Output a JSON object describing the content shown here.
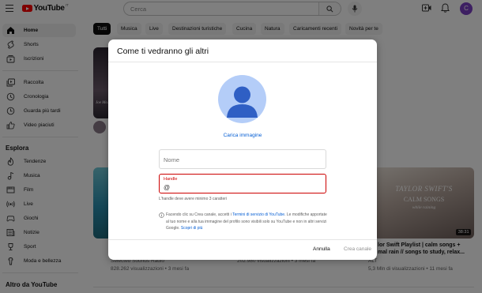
{
  "header": {
    "logo_text": "YouTube",
    "logo_country": "IT",
    "search_placeholder": "Cerca",
    "avatar_letter": "C"
  },
  "sidebar": {
    "items": [
      {
        "label": "Home",
        "icon": "home-icon",
        "active": true
      },
      {
        "label": "Shorts",
        "icon": "shorts-icon"
      },
      {
        "label": "Iscrizioni",
        "icon": "subscriptions-icon"
      },
      {
        "label": "Raccolta",
        "icon": "library-icon"
      },
      {
        "label": "Cronologia",
        "icon": "history-icon"
      },
      {
        "label": "Guarda più tardi",
        "icon": "watch-later-icon"
      },
      {
        "label": "Video piaciuti",
        "icon": "liked-videos-icon"
      }
    ],
    "explore_heading": "Esplora",
    "explore_items": [
      {
        "label": "Tendenze",
        "icon": "trending-icon"
      },
      {
        "label": "Musica",
        "icon": "music-icon"
      },
      {
        "label": "Film",
        "icon": "film-icon"
      },
      {
        "label": "Live",
        "icon": "live-icon"
      },
      {
        "label": "Giochi",
        "icon": "gaming-icon"
      },
      {
        "label": "Notizie",
        "icon": "news-icon"
      },
      {
        "label": "Sport",
        "icon": "sport-icon"
      },
      {
        "label": "Moda e bellezza",
        "icon": "fashion-icon"
      }
    ],
    "more_heading": "Altro da YouTube"
  },
  "chips": [
    "Tutti",
    "Musica",
    "Live",
    "Destinazioni turistiche",
    "Cucina",
    "Natura",
    "Caricamenti recenti",
    "Novità per te"
  ],
  "videos": {
    "left": {
      "channel": "Selected Sounds Radio",
      "stats": "828.262 visualizzazioni • 3 mesi fa",
      "thumb_text": "Joe Mo..."
    },
    "middle": {
      "stats": "202.980 visualizzazioni • 3 mesi fa"
    },
    "right": {
      "title_line1": "lor Swift Playlist | calm songs +",
      "title_line2": "mal rain // songs to study, relax...",
      "channel": "ALT",
      "stats": "5,3 Mln di visualizzazioni • 11 mesi fa",
      "duration": "38:31",
      "thumb_line1": "TAYLOR SWIFT'S",
      "thumb_line2": "CALM SONGS",
      "thumb_line3": "while raining"
    }
  },
  "dialog": {
    "title": "Come ti vedranno gli altri",
    "upload_image": "Carica immagine",
    "name_placeholder": "Nome",
    "handle_label": "Handle",
    "handle_value": "@",
    "handle_error": "L'handle deve avere minimo 3 caratteri",
    "legal_pre": "Facendo clic su Crea canale, accetti i ",
    "legal_tos": "Termini di servizio di YouTube",
    "legal_mid": ". Le modifiche apportate al tuo nome e alla tua immagine del profilo sono visibili solo su YouTube e non in altri servizi Google. ",
    "legal_more": "Scopri di più",
    "cancel": "Annulla",
    "create": "Crea canale"
  },
  "colors": {
    "youtube_red": "#ff0000",
    "link_blue": "#065fd4",
    "error_red": "#cc0000",
    "avatar_purple": "#7b3fc4"
  }
}
